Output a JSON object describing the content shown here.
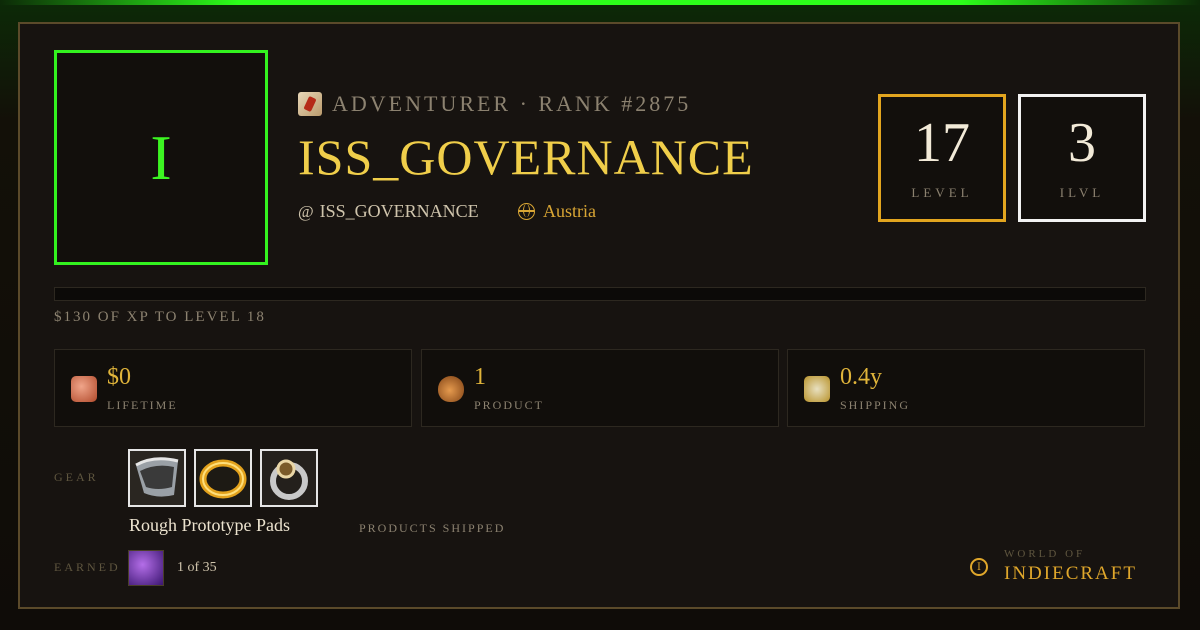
{
  "profile": {
    "avatar_letter": "I",
    "rank_line": "ADVENTURER · RANK #2875",
    "name": "ISS_GOVERNANCE",
    "handle": "ISS_GOVERNANCE",
    "handle_prefix": "@",
    "location": "Austria"
  },
  "stats": {
    "level": {
      "value": "17",
      "label": "LEVEL"
    },
    "ilvl": {
      "value": "3",
      "label": "ILVL"
    }
  },
  "xp": {
    "text": "$130 OF XP TO LEVEL 18",
    "progress": 0
  },
  "tiles": [
    {
      "value": "$0",
      "label": "LIFETIME",
      "icon": "coin-scroll-icon"
    },
    {
      "value": "1",
      "label": "PRODUCT",
      "icon": "pouch-icon"
    },
    {
      "value": "0.4y",
      "label": "SHIPPING",
      "icon": "compass-icon"
    }
  ],
  "gear": {
    "label": "GEAR",
    "items": [
      {
        "icon": "shoulder-pads-icon"
      },
      {
        "icon": "gold-ring-icon"
      },
      {
        "icon": "silver-ring-icon"
      }
    ],
    "item_name": "Rough Prototype Pads",
    "item_sub": "PRODUCTS SHIPPED"
  },
  "earned": {
    "label": "EARNED",
    "badge_icon": "purple-gem-icon",
    "count": "1 of 35"
  },
  "brand": {
    "top": "WORLD OF",
    "main": "INDIECRAFT"
  },
  "colors": {
    "accent_green": "#33f21f",
    "accent_gold": "#e2a51f",
    "name_gold": "#f0ce4a"
  }
}
